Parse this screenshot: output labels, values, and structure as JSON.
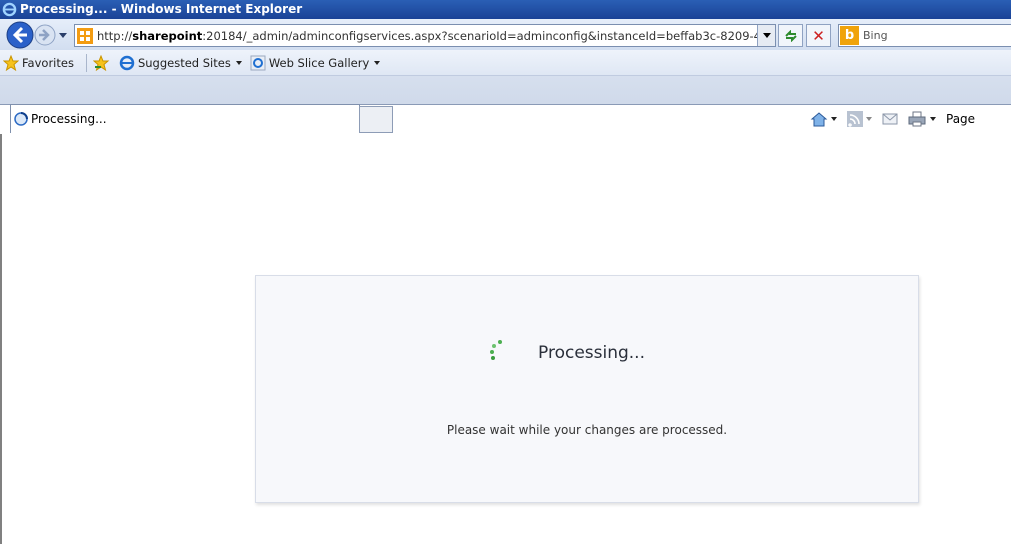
{
  "window": {
    "title": "Processing... - Windows Internet Explorer"
  },
  "address_bar": {
    "url_prefix": "http://",
    "url_host": "sharepoint",
    "url_rest": ":20184/_admin/adminconfigservices.aspx?scenarioId=adminconfig&instanceId=beffab3c-8209-4",
    "search_provider": "Bing"
  },
  "favorites_bar": {
    "favorites_label": "Favorites",
    "suggested_sites": "Suggested Sites",
    "web_slice_gallery": "Web Slice Gallery"
  },
  "tabs": [
    {
      "label": "Processing..."
    }
  ],
  "command_bar": {
    "page_label": "Page"
  },
  "dialog": {
    "title": "Processing...",
    "message": "Please wait while your changes are processed."
  },
  "colors": {
    "titlebar": "#1a4296",
    "spinner_green": "#4caf50"
  }
}
